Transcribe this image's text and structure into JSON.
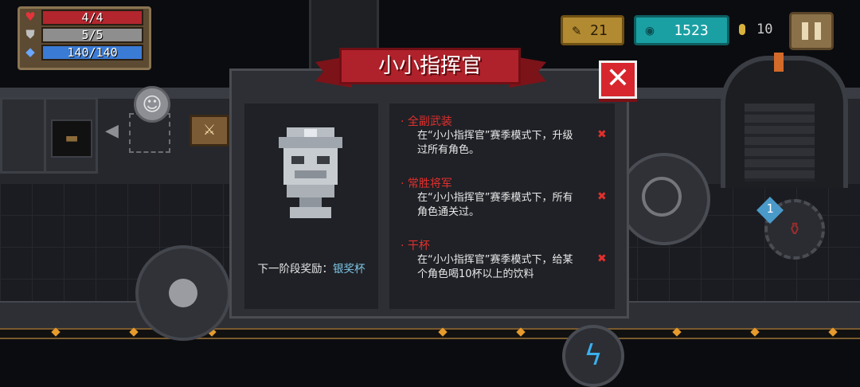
{
  "hud": {
    "health": "4/4",
    "armor": "5/5",
    "energy": "140/140",
    "gold": "21",
    "gems": "1523",
    "coins": "10"
  },
  "modal": {
    "title": "小小指挥官",
    "next_reward_label": "下一阶段奖励：",
    "next_reward_name": "银奖杯",
    "achievements": [
      {
        "title": "全副武装",
        "line1": "在“小小指挥官”赛季模式下，升级",
        "line2": "过所有角色。"
      },
      {
        "title": "常胜将军",
        "line1": "在“小小指挥官”赛季模式下，所有",
        "line2": "角色通关过。"
      },
      {
        "title": "干杯",
        "line1": "在“小小指挥官”赛季模式下，给某",
        "line2": "个角色喝10杯以上的饮料"
      }
    ],
    "close_symbol": "✕",
    "status_mark": "✖"
  },
  "skill": {
    "badge": "1"
  },
  "colors": {
    "accent_red": "#b0222b",
    "health": "#b3262e",
    "armor": "#9a9a9a",
    "energy": "#3a7bd5",
    "gem": "#1aa0a3",
    "gold": "#b28a31"
  },
  "icons": [
    "heart-icon",
    "shield-icon",
    "diamond-icon",
    "feather-icon",
    "gem-icon",
    "coin-icon",
    "pause-icon",
    "smiley-icon",
    "lightning-icon",
    "crosshair-icon",
    "close-icon"
  ]
}
